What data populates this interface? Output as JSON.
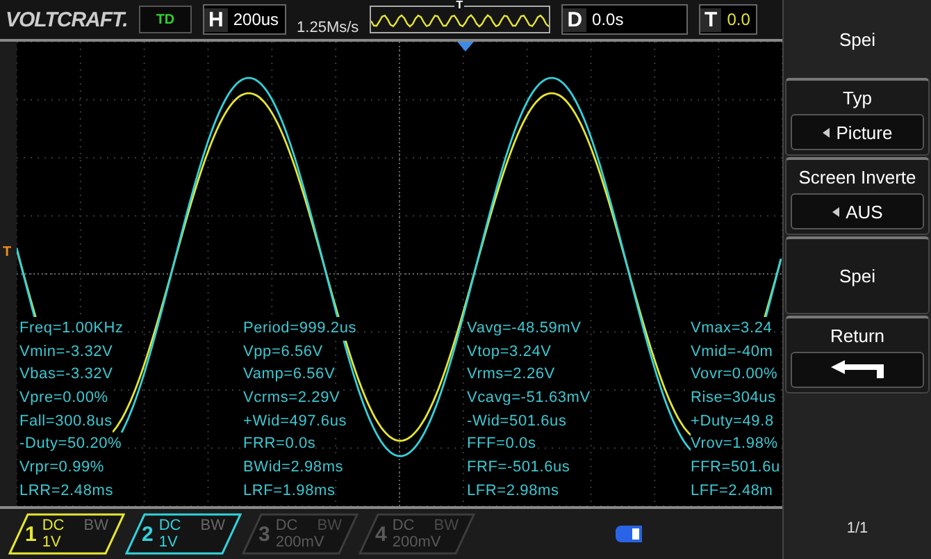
{
  "brand": "VOLTCRAFT.",
  "status": "TD",
  "timebase": {
    "label": "H",
    "value": "200us"
  },
  "sample_rate": "1.25Ms/s",
  "overview": {
    "marker": "T"
  },
  "delay": {
    "label": "D",
    "value": "0.0s"
  },
  "trigger_level": {
    "label": "T",
    "value": "0.0"
  },
  "trigger_marker": "T",
  "measurements": [
    [
      "Freq=1.00KHz",
      "Vmin=-3.32V",
      "Vbas=-3.32V",
      "Vpre=0.00%",
      "Fall=300.8us",
      "-Duty=50.20%",
      "Vrpr=0.99%",
      "LRR=2.48ms"
    ],
    [
      "Period=999.2us",
      "Vpp=6.56V",
      "Vamp=6.56V",
      "Vcrms=2.29V",
      "+Wid=497.6us",
      "FRR=0.0s",
      "BWid=2.98ms",
      "LRF=1.98ms"
    ],
    [
      "Vavg=-48.59mV",
      "Vtop=3.24V",
      "Vrms=2.26V",
      "Vcavg=-51.63mV",
      "-Wid=501.6us",
      "FFF=0.0s",
      "FRF=-501.6us",
      "LFR=2.98ms"
    ],
    [
      "Vmax=3.24",
      "Vmid=-40m",
      "Vovr=0.00%",
      "Rise=304us",
      "+Duty=49.8",
      "Vrov=1.98%",
      "FFR=501.6u",
      "LFF=2.48m"
    ]
  ],
  "channels": [
    {
      "number": "1",
      "coupling": "DC",
      "bw": "BW",
      "scale": "1V",
      "enabled": true,
      "color": "#e6e632"
    },
    {
      "number": "2",
      "coupling": "DC",
      "bw": "BW",
      "scale": "1V",
      "enabled": true,
      "color": "#32d2dc"
    },
    {
      "number": "3",
      "coupling": "DC",
      "bw": "BW",
      "scale": "200mV",
      "enabled": false,
      "color": "#3c3c3c"
    },
    {
      "number": "4",
      "coupling": "DC",
      "bw": "BW",
      "scale": "200mV",
      "enabled": false,
      "color": "#3c3c3c"
    }
  ],
  "menu": {
    "title": "Spei",
    "items": [
      {
        "kind": "option",
        "label": "Typ",
        "value": "Picture"
      },
      {
        "kind": "option",
        "label": "Screen Inverte",
        "value": "AUS"
      },
      {
        "kind": "action",
        "label": "Spei"
      },
      {
        "kind": "return",
        "label": "Return"
      }
    ],
    "page": "1/1"
  }
}
